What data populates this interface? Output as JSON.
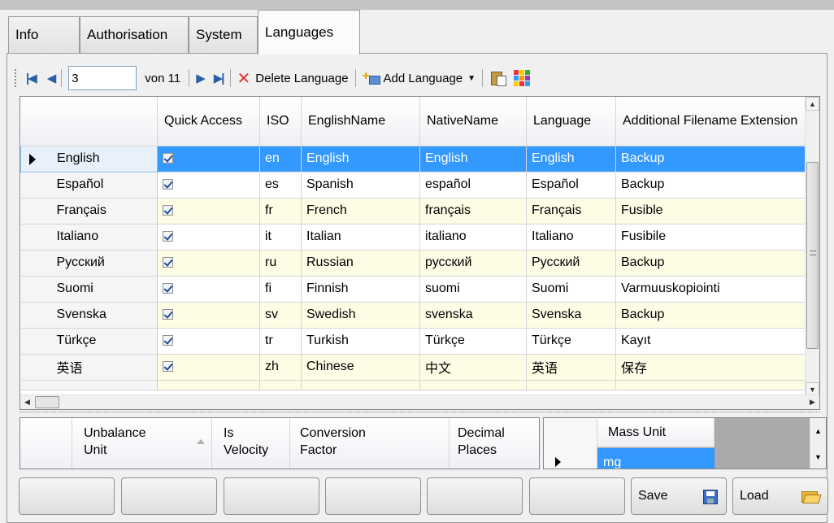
{
  "tabs": [
    {
      "label": "Info",
      "active": false
    },
    {
      "label": "Authorisation",
      "active": false
    },
    {
      "label": "System",
      "active": false
    },
    {
      "label": "Languages",
      "active": true
    }
  ],
  "toolbar": {
    "page_value": "3",
    "of_text": "von 11",
    "delete_label": "Delete Language",
    "add_label": "Add Language"
  },
  "grid": {
    "columns": [
      "Quick Access",
      "ISO",
      "EnglishName",
      "NativeName",
      "Language",
      "Additional Filename Extension"
    ],
    "selected_index": 0,
    "rows": [
      {
        "header": "English",
        "quick": true,
        "iso": "en",
        "english": "English",
        "native": "English",
        "language": "English",
        "ext": "Backup"
      },
      {
        "header": "Español",
        "quick": true,
        "iso": "es",
        "english": "Spanish",
        "native": "español",
        "language": "Español",
        "ext": "Backup"
      },
      {
        "header": "Français",
        "quick": true,
        "iso": "fr",
        "english": "French",
        "native": "français",
        "language": "Français",
        "ext": "Fusible"
      },
      {
        "header": "Italiano",
        "quick": true,
        "iso": "it",
        "english": "Italian",
        "native": "italiano",
        "language": "Italiano",
        "ext": "Fusibile"
      },
      {
        "header": "Русский",
        "quick": true,
        "iso": "ru",
        "english": "Russian",
        "native": "русский",
        "language": "Русский",
        "ext": "Backup"
      },
      {
        "header": "Suomi",
        "quick": true,
        "iso": "fi",
        "english": "Finnish",
        "native": "suomi",
        "language": "Suomi",
        "ext": "Varmuuskopiointi"
      },
      {
        "header": "Svenska",
        "quick": true,
        "iso": "sv",
        "english": "Swedish",
        "native": "svenska",
        "language": "Svenska",
        "ext": "Backup"
      },
      {
        "header": "Türkçe",
        "quick": true,
        "iso": "tr",
        "english": "Turkish",
        "native": "Türkçe",
        "language": "Türkçe",
        "ext": "Kayıt"
      },
      {
        "header": "英语",
        "quick": true,
        "iso": "zh",
        "english": "Chinese",
        "native": "中文",
        "language": "英语",
        "ext": "保存"
      }
    ]
  },
  "unit_grid": {
    "columns": [
      "Unbalance Unit",
      "Is Velocity",
      "Conversion Factor",
      "Decimal Places"
    ]
  },
  "mass_grid": {
    "column": "Mass Unit",
    "value": "mg"
  },
  "buttons": {
    "save_label": "Save",
    "load_label": "Load"
  },
  "colors": {
    "selection": "#3399ff",
    "alt_row": "#fdfde6",
    "delete_icon": "#dd3333"
  }
}
